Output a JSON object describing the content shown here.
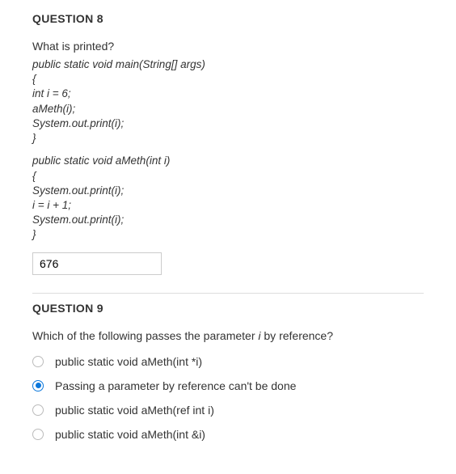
{
  "q8": {
    "title": "QUESTION 8",
    "prompt": "What is printed?",
    "code1": "public static void main(String[] args)\n{\nint i = 6;\naMeth(i);\nSystem.out.print(i);\n}",
    "code2": "public static void aMeth(int i)\n{\nSystem.out.print(i);\ni = i + 1;\nSystem.out.print(i);\n}",
    "answer_value": "676"
  },
  "q9": {
    "title": "QUESTION 9",
    "prompt_pre": "Which of the following passes the parameter ",
    "prompt_ital": "i",
    "prompt_post": " by reference?",
    "options": [
      {
        "label": "public static void aMeth(int *i)",
        "selected": false
      },
      {
        "label": "Passing a parameter by reference can't be done",
        "selected": true
      },
      {
        "label": "public static void aMeth(ref int i)",
        "selected": false
      },
      {
        "label": "public static void aMeth(int &i)",
        "selected": false
      }
    ]
  }
}
